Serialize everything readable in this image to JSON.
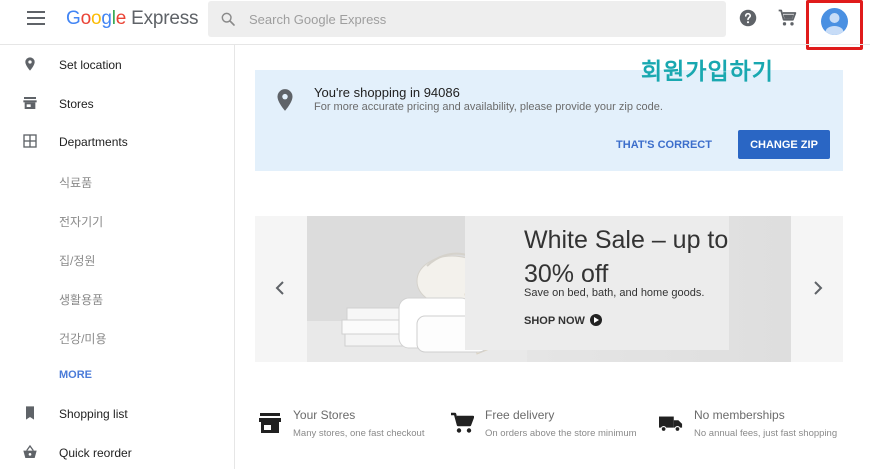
{
  "header": {
    "logo_google": [
      "G",
      "o",
      "o",
      "g",
      "l",
      "e"
    ],
    "logo_express": "Express",
    "search_placeholder": "Search Google Express"
  },
  "sidebar": {
    "items": [
      {
        "label": "Set location",
        "icon": "location-pin-icon"
      },
      {
        "label": "Stores",
        "icon": "store-icon"
      },
      {
        "label": "Departments",
        "icon": "grid-icon"
      }
    ],
    "departments": [
      "식료품",
      "전자기기",
      "집/정원",
      "생활용품",
      "건강/미용"
    ],
    "more": "MORE",
    "bottom_items": [
      {
        "label": "Shopping list",
        "icon": "bookmark-icon"
      },
      {
        "label": "Quick reorder",
        "icon": "basket-icon"
      }
    ]
  },
  "overlay": {
    "signup_text": "회원가입하기",
    "highlight_color": "#e01b1b"
  },
  "location_card": {
    "title": "You're shopping in 94086",
    "subtitle": "For more accurate pricing and availability, please provide your zip code.",
    "confirm_label": "THAT'S CORRECT",
    "change_label": "CHANGE ZIP"
  },
  "carousel": {
    "title": "White Sale – up to 30% off",
    "subtitle": "Save on bed, bath, and home goods.",
    "cta": "SHOP NOW"
  },
  "features": [
    {
      "title": "Your Stores",
      "subtitle": "Many stores, one fast checkout",
      "icon": "store-icon"
    },
    {
      "title": "Free delivery",
      "subtitle": "On orders above the store minimum",
      "icon": "cart-icon"
    },
    {
      "title": "No memberships",
      "subtitle": "No annual fees, just fast shopping",
      "icon": "truck-icon"
    }
  ],
  "colors": {
    "accent_blue": "#2a66c4",
    "link_blue": "#3c6ecb",
    "card_bg": "#e3f0fb",
    "signup_teal": "#19a8b0"
  }
}
